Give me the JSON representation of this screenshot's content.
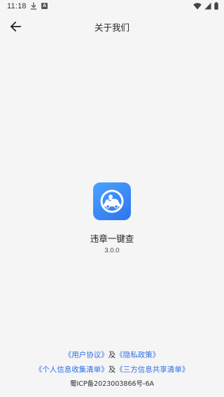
{
  "status_bar": {
    "time": "11:18",
    "notification_badge": "A",
    "icons": [
      "download-icon",
      "wifi-icon",
      "signal-icon",
      "battery-icon"
    ]
  },
  "app_bar": {
    "title": "关于我们",
    "back_icon": "arrow-left-icon"
  },
  "app": {
    "name": "违章一键查",
    "version": "3.0.0",
    "logo_icon": "car-steering-wheel-icon",
    "logo_color": "#3a8bf5"
  },
  "footer": {
    "user_agreement": "《用户协议》",
    "and_1": "及",
    "privacy_policy": "《隐私政策》",
    "personal_info_list": "《个人信息收集清单》",
    "and_2": "及",
    "third_party_list": "《三方信息共享清单》",
    "icp": "蜀ICP备2023003866号-6A"
  },
  "colors": {
    "background": "#f5f5f5",
    "link": "#2f6fe6",
    "text": "#222222"
  }
}
